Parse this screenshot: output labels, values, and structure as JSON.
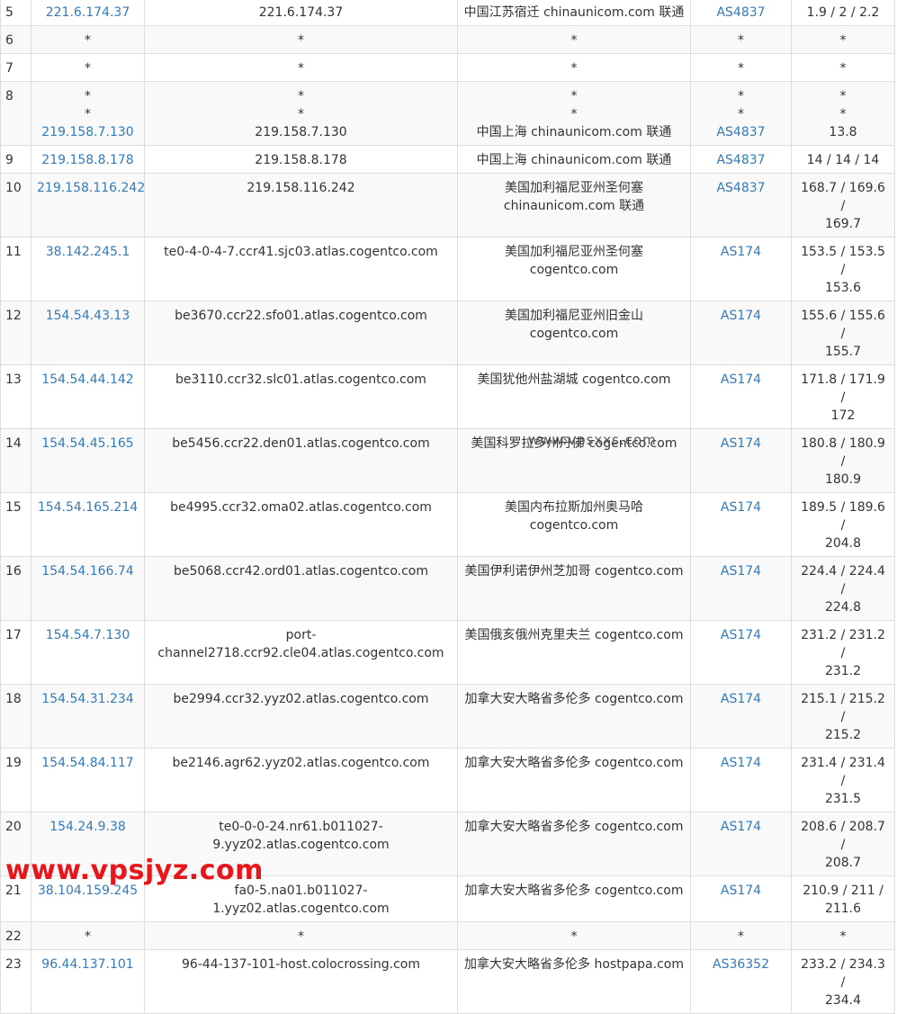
{
  "rows": [
    {
      "hop": "5",
      "ip": [
        "221.6.174.37"
      ],
      "host": [
        "221.6.174.37"
      ],
      "loc": [
        "中国江苏宿迁 chinaunicom.com 联通"
      ],
      "asn": [
        "AS4837"
      ],
      "time": [
        "1.9 / 2 / 2.2"
      ]
    },
    {
      "hop": "6",
      "ip": [
        "*"
      ],
      "host": [
        "*"
      ],
      "loc": [
        "*"
      ],
      "asn": [
        "*"
      ],
      "time": [
        "*"
      ]
    },
    {
      "hop": "7",
      "ip": [
        "*"
      ],
      "host": [
        "*"
      ],
      "loc": [
        "*"
      ],
      "asn": [
        "*"
      ],
      "time": [
        "*"
      ]
    },
    {
      "hop": "8",
      "ip": [
        "*",
        "*",
        "219.158.7.130"
      ],
      "host": [
        "*",
        "*",
        "219.158.7.130"
      ],
      "loc": [
        "*",
        "*",
        "中国上海 chinaunicom.com 联通"
      ],
      "asn": [
        "*",
        "*",
        "AS4837"
      ],
      "time": [
        "*",
        "*",
        "13.8"
      ]
    },
    {
      "hop": "9",
      "ip": [
        "219.158.8.178"
      ],
      "host": [
        "219.158.8.178"
      ],
      "loc": [
        "中国上海 chinaunicom.com 联通"
      ],
      "asn": [
        "AS4837"
      ],
      "time": [
        "14 / 14 / 14"
      ]
    },
    {
      "hop": "10",
      "ip": [
        "219.158.116.242"
      ],
      "host": [
        "219.158.116.242"
      ],
      "loc": [
        "美国加利福尼亚州圣何塞",
        "chinaunicom.com 联通"
      ],
      "asn": [
        "AS4837"
      ],
      "time": [
        "168.7 / 169.6 /",
        "169.7"
      ]
    },
    {
      "hop": "11",
      "ip": [
        "38.142.245.1"
      ],
      "host": [
        "te0-4-0-4-7.ccr41.sjc03.atlas.cogentco.com"
      ],
      "loc": [
        "美国加利福尼亚州圣何塞",
        "cogentco.com"
      ],
      "asn": [
        "AS174"
      ],
      "time": [
        "153.5 / 153.5 /",
        "153.6"
      ]
    },
    {
      "hop": "12",
      "ip": [
        "154.54.43.13"
      ],
      "host": [
        "be3670.ccr22.sfo01.atlas.cogentco.com"
      ],
      "loc": [
        "美国加利福尼亚州旧金山",
        "cogentco.com"
      ],
      "asn": [
        "AS174"
      ],
      "time": [
        "155.6 / 155.6 /",
        "155.7"
      ]
    },
    {
      "hop": "13",
      "ip": [
        "154.54.44.142"
      ],
      "host": [
        "be3110.ccr32.slc01.atlas.cogentco.com"
      ],
      "loc": [
        "美国犹他州盐湖城 cogentco.com"
      ],
      "asn": [
        "AS174"
      ],
      "time": [
        "171.8 / 171.9 /",
        "172"
      ]
    },
    {
      "hop": "14",
      "ip": [
        "154.54.45.165"
      ],
      "host": [
        "be5456.ccr22.den01.atlas.cogentco.com"
      ],
      "loc": [
        "美国科罗拉多州丹佛 cogentco.com"
      ],
      "asn": [
        "AS174"
      ],
      "time": [
        "180.8 / 180.9 /",
        "180.9"
      ]
    },
    {
      "hop": "15",
      "ip": [
        "154.54.165.214"
      ],
      "host": [
        "be4995.ccr32.oma02.atlas.cogentco.com"
      ],
      "loc": [
        "美国内布拉斯加州奥马哈",
        "cogentco.com"
      ],
      "asn": [
        "AS174"
      ],
      "time": [
        "189.5 / 189.6 /",
        "204.8"
      ]
    },
    {
      "hop": "16",
      "ip": [
        "154.54.166.74"
      ],
      "host": [
        "be5068.ccr42.ord01.atlas.cogentco.com"
      ],
      "loc": [
        "美国伊利诺伊州芝加哥 cogentco.com"
      ],
      "asn": [
        "AS174"
      ],
      "time": [
        "224.4 / 224.4 /",
        "224.8"
      ]
    },
    {
      "hop": "17",
      "ip": [
        "154.54.7.130"
      ],
      "host": [
        "port-channel2718.ccr92.cle04.atlas.cogentco.com"
      ],
      "loc": [
        "美国俄亥俄州克里夫兰 cogentco.com"
      ],
      "asn": [
        "AS174"
      ],
      "time": [
        "231.2 / 231.2 /",
        "231.2"
      ]
    },
    {
      "hop": "18",
      "ip": [
        "154.54.31.234"
      ],
      "host": [
        "be2994.ccr32.yyz02.atlas.cogentco.com"
      ],
      "loc": [
        "加拿大安大略省多伦多 cogentco.com"
      ],
      "asn": [
        "AS174"
      ],
      "time": [
        "215.1 / 215.2 /",
        "215.2"
      ]
    },
    {
      "hop": "19",
      "ip": [
        "154.54.84.117"
      ],
      "host": [
        "be2146.agr62.yyz02.atlas.cogentco.com"
      ],
      "loc": [
        "加拿大安大略省多伦多 cogentco.com"
      ],
      "asn": [
        "AS174"
      ],
      "time": [
        "231.4 / 231.4 /",
        "231.5"
      ]
    },
    {
      "hop": "20",
      "ip": [
        "154.24.9.38"
      ],
      "host": [
        "te0-0-0-24.nr61.b011027-",
        "9.yyz02.atlas.cogentco.com"
      ],
      "loc": [
        "加拿大安大略省多伦多 cogentco.com"
      ],
      "asn": [
        "AS174"
      ],
      "time": [
        "208.6 / 208.7 /",
        "208.7"
      ]
    },
    {
      "hop": "21",
      "ip": [
        "38.104.159.245"
      ],
      "host": [
        "fa0-5.na01.b011027-1.yyz02.atlas.cogentco.com"
      ],
      "loc": [
        "加拿大安大略省多伦多 cogentco.com"
      ],
      "asn": [
        "AS174"
      ],
      "time": [
        "210.9 / 211 /",
        "211.6"
      ]
    },
    {
      "hop": "22",
      "ip": [
        "*"
      ],
      "host": [
        "*"
      ],
      "loc": [
        "*"
      ],
      "asn": [
        "*"
      ],
      "time": [
        "*"
      ]
    },
    {
      "hop": "23",
      "ip": [
        "96.44.137.101"
      ],
      "host": [
        "96-44-137-101-host.colocrossing.com"
      ],
      "loc": [
        "加拿大安大略省多伦多 hostpapa.com"
      ],
      "asn": [
        "AS36352"
      ],
      "time": [
        "233.2 / 234.3 /",
        "234.4"
      ]
    }
  ],
  "watermark_center": "www.vpsxxs.com",
  "watermark_bottom": "www.vpsjyz.com",
  "colors": {
    "link": "#337ab7",
    "border": "#dddddd",
    "stripe": "#f9f9f9",
    "watermark": "#e8151a"
  }
}
